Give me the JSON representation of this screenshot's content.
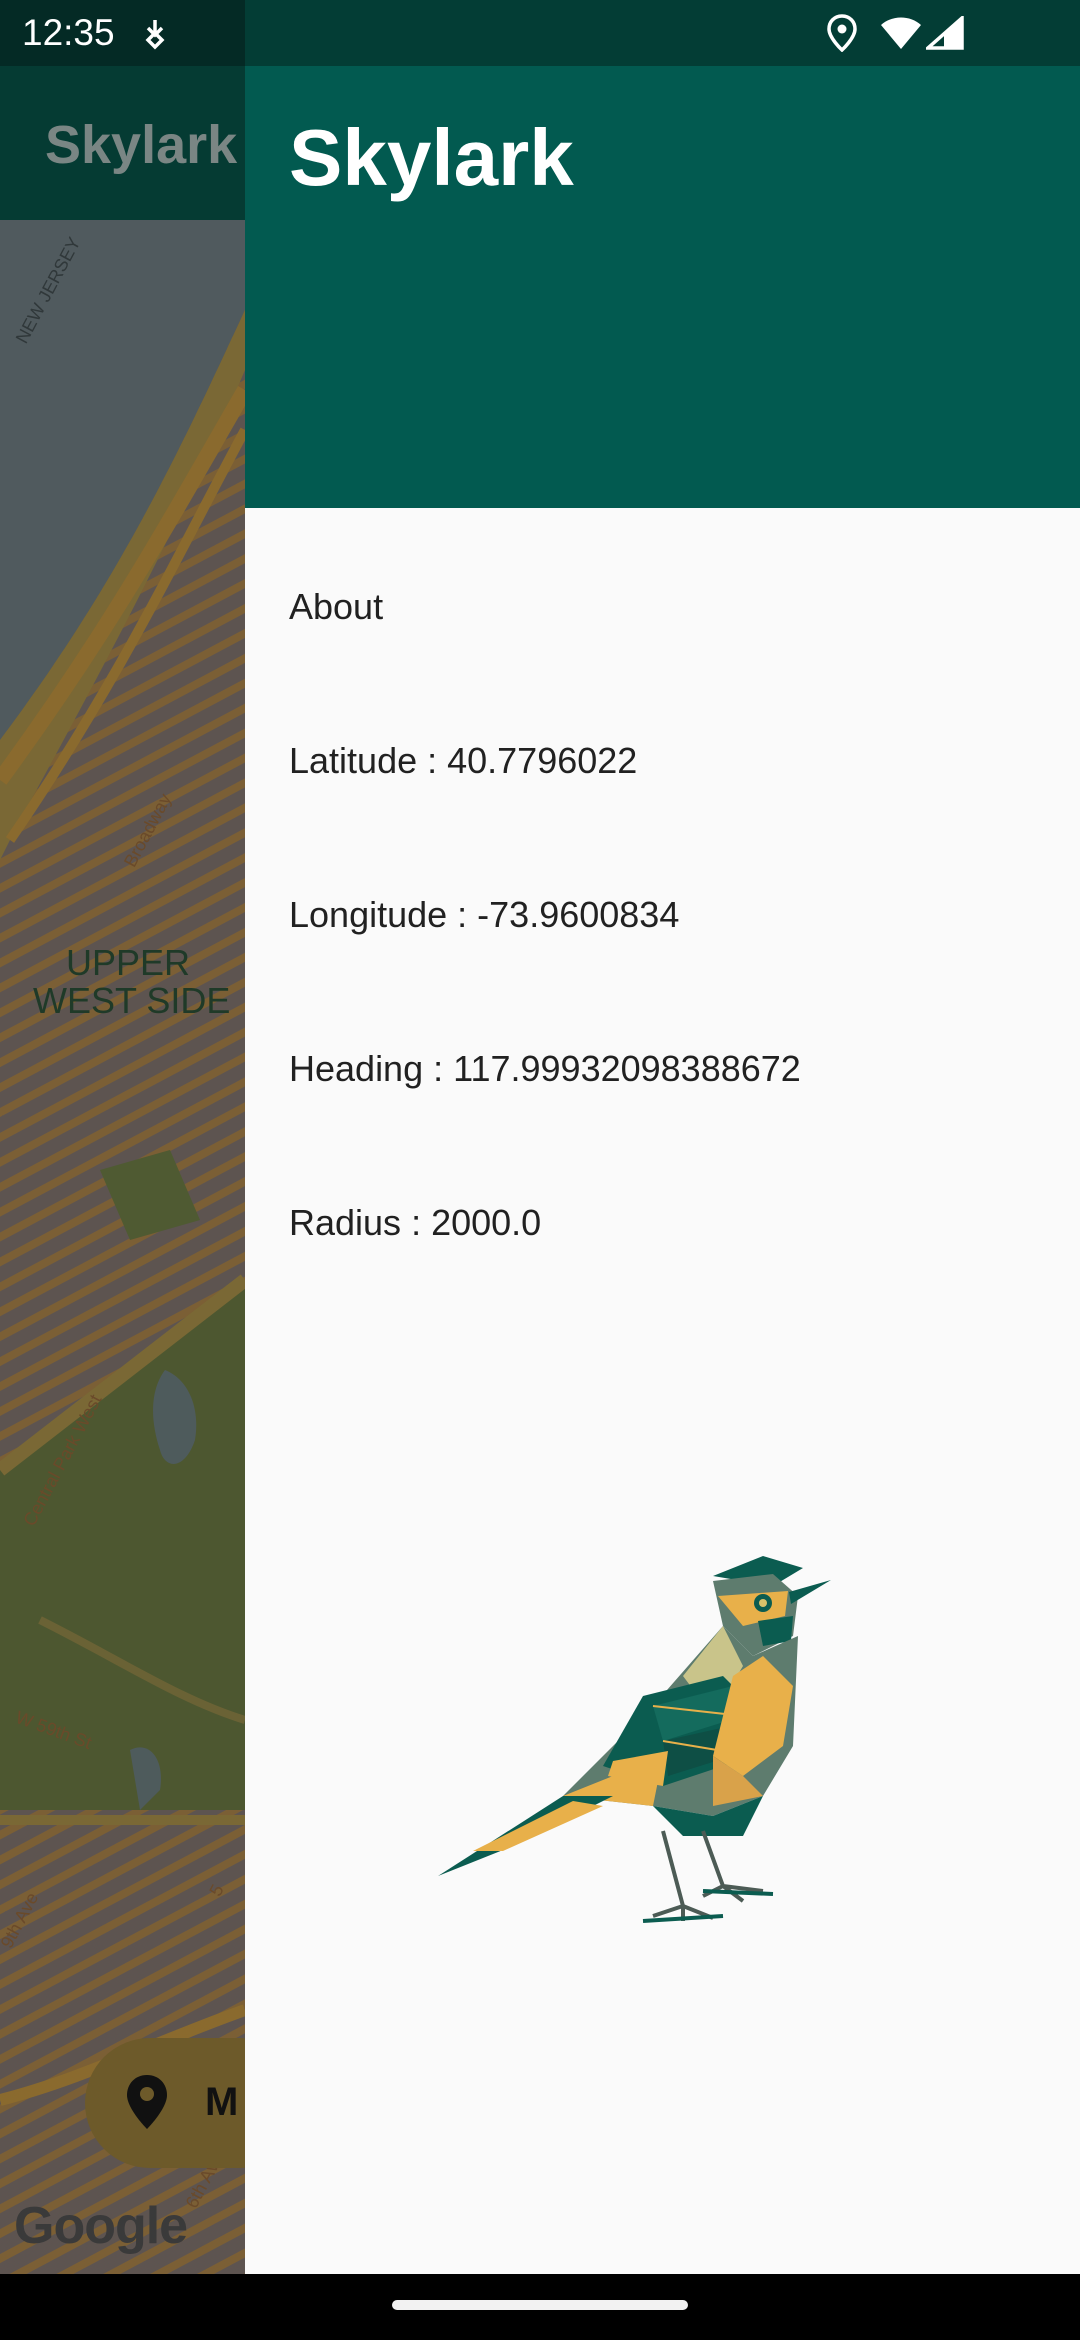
{
  "status_bar": {
    "time": "12:35",
    "icons": [
      "download-icon",
      "location-icon",
      "wifi-icon",
      "cell-signal-icon"
    ]
  },
  "app": {
    "title": "Skylark",
    "map": {
      "labels": {
        "state": "NEW JERSEY",
        "neighborhood_line1": "UPPER",
        "neighborhood_line2": "WEST SIDE",
        "street_broadway": "Broadway",
        "street_cpw": "Central Park West",
        "street_59th": "W 59th St",
        "street_9th": "9th Ave",
        "street_6th": "6th Ave",
        "street_5th": "5"
      },
      "attribution": "Google"
    },
    "fab_label": "M"
  },
  "drawer": {
    "title": "Skylark",
    "items": [
      "About",
      "Latitude : 40.7796022",
      "Longitude : -73.9600834",
      "Heading : 117.99932098388672",
      "Radius : 2000.0"
    ]
  },
  "colors": {
    "header": "#025a50",
    "drawer_bg": "#fafafa",
    "bird_gold": "#e8b04a",
    "bird_teal": "#0b5c50",
    "bird_sage": "#5e7c6e"
  }
}
